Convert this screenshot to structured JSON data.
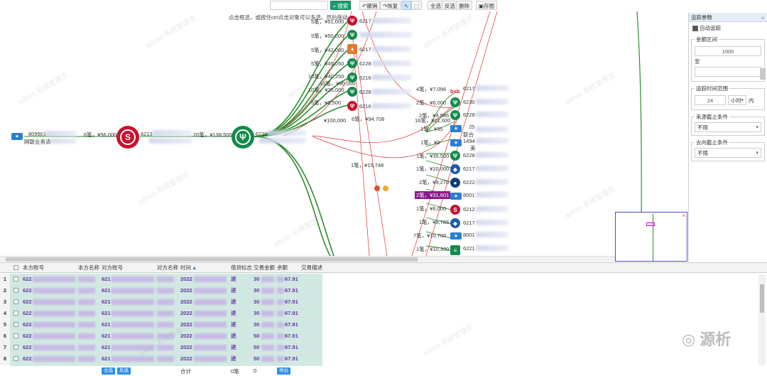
{
  "toolbar": {
    "search": "搜索",
    "undo": "撤销",
    "redo": "恢复",
    "select_all": "全选",
    "invert": "反选",
    "delete": "删除",
    "save_image": "存图"
  },
  "hint": "点击框选，或按住ctrl点击对象可以多选。然后拖动",
  "left_node": {
    "id": "809901",
    "name": "网联业务清"
  },
  "edges": {
    "e1": "6笔，¥56,000",
    "e2": "20笔，¥138,500",
    "top1": "5笔，¥51,000",
    "top2": "5笔，¥50,000",
    "top3": "5笔，¥42,000",
    "top4": "5笔，¥45,050",
    "top5": "10笔，¥40,250",
    "top6": "10笔，¥90,000",
    "top7": "10笔，¥25,000",
    "top8": "5笔，¥2,500",
    "mid1": "6笔，¥94,708",
    "mid2": "¥100,000",
    "mid3": "1笔，¥15,748",
    "r1": "4笔，¥7,096",
    "r2": "2笔，¥6,000",
    "r3": "2笔，¥4,586",
    "r4": "16笔，¥21,600",
    "r5": "1笔，¥35",
    "r6": "1笔，¥9",
    "r7": "1笔，¥35,500",
    "r8": "1笔，¥10,000",
    "r9": "2笔，¥9,270",
    "r10": "2笔，¥31,601",
    "r11": "1笔，¥6,000",
    "r12": "1笔，¥9,786",
    "r13": "7笔，¥10,700",
    "r14": "1笔，¥10,300"
  },
  "nodes_right": {
    "n1": "6217",
    "n2": "6230",
    "n3": "6228",
    "n4": "25",
    "n4b": "联合",
    "n5": "1494",
    "n5b": "美",
    "n6": "6228",
    "n7": "6217",
    "n8": "6222",
    "n9": "8001",
    "n10": "6212",
    "n11": "6217",
    "n12": "8001",
    "n13": "6221"
  },
  "nodes_top": {
    "t1": "6217",
    "t2": "6217",
    "t3": "6228",
    "t4": "6216",
    "t5": "6228",
    "t6": "6216"
  },
  "node_a": "6213",
  "node_b": "6228",
  "bsb": "bsb",
  "watermark": "admin 系统管理员",
  "right_panel": {
    "title": "追踪参数",
    "auto_trace": "自动追踪",
    "amount_legend": "金额区间",
    "amount_from": "1000",
    "amount_to_label": "至",
    "time_legend": "追踪时间范围",
    "time_value": "24",
    "time_unit": "小时",
    "time_suffix": "内",
    "source_legend": "来源截止条件",
    "source_value": "不限",
    "dest_legend": "去向截止条件",
    "dest_value": "不限"
  },
  "grid": {
    "headers": [
      "本方账号",
      "本方名称",
      "对方账号",
      "对方名称",
      "时间",
      "借贷标志",
      "交易金额",
      "余额",
      "交易描述"
    ],
    "rows": [
      {
        "n": "1",
        "acct": "622",
        "cp": "621",
        "time": "2022",
        "flag": "进",
        "amt": "30",
        "bal": "67.91"
      },
      {
        "n": "2",
        "acct": "622",
        "cp": "621",
        "time": "2022",
        "flag": "进",
        "amt": "30",
        "bal": "67.91"
      },
      {
        "n": "3",
        "acct": "622",
        "cp": "621",
        "time": "2022",
        "flag": "进",
        "amt": "30",
        "bal": "67.91"
      },
      {
        "n": "4",
        "acct": "622",
        "cp": "621",
        "time": "2022",
        "flag": "进",
        "amt": "30",
        "bal": "67.91"
      },
      {
        "n": "5",
        "acct": "622",
        "cp": "621",
        "time": "2022",
        "flag": "进",
        "amt": "30",
        "bal": "67.91"
      },
      {
        "n": "6",
        "acct": "622",
        "cp": "621",
        "time": "2022",
        "flag": "进",
        "amt": "50",
        "bal": "67.91"
      },
      {
        "n": "7",
        "acct": "622",
        "cp": "621",
        "time": "2022",
        "flag": "进",
        "amt": "50",
        "bal": "67.91"
      },
      {
        "n": "8",
        "acct": "622",
        "cp": "621",
        "time": "2022",
        "flag": "进",
        "amt": "50",
        "bal": "67.91"
      }
    ],
    "footer": {
      "select_all": "全选",
      "invert": "反选",
      "total_label": "合计",
      "count": "0笔",
      "sum": "0",
      "export": "导出"
    }
  },
  "brand": "源析"
}
